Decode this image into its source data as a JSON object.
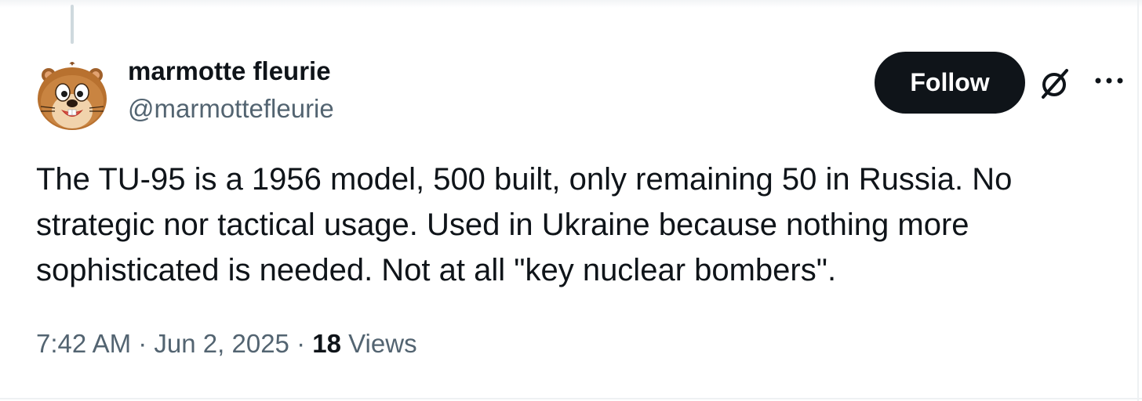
{
  "author": {
    "display_name": "marmotte fleurie",
    "handle": "@marmottefleurie",
    "avatar_icon": "marmot-avatar"
  },
  "actions": {
    "follow_label": "Follow",
    "grok_icon": "grok-icon",
    "more_icon": "more-icon"
  },
  "tweet": {
    "lines": [
      "The TU-95 is a 1956 model, 500 built, only remaining 50 in Russia. No",
      "strategic nor tactical usage. Used in Ukraine because nothing more",
      "sophisticated is needed. Not at all \"key nuclear bombers\"."
    ]
  },
  "meta": {
    "time": "7:42 AM",
    "separator": "·",
    "date": "Jun 2, 2025",
    "views_count": "18",
    "views_label": "Views"
  },
  "colors": {
    "text_primary": "#0f1419",
    "text_secondary": "#536471",
    "follow_bg": "#0f1419",
    "thread_line": "#cfd9de"
  }
}
